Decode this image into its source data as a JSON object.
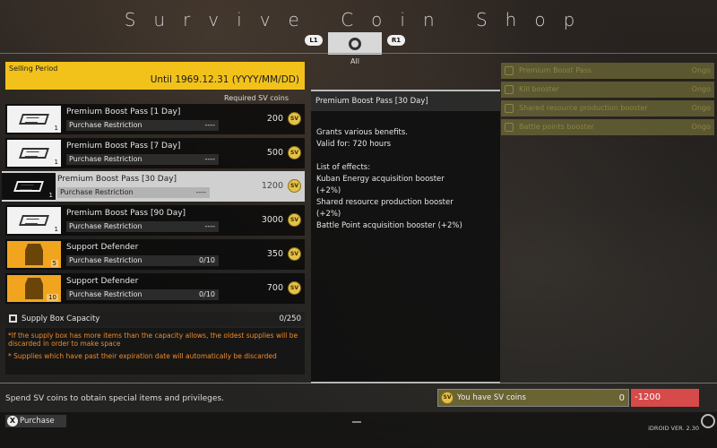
{
  "title": "Survive Coin Shop",
  "tabs": {
    "left_button": "L1",
    "right_button": "R1",
    "active_label": "All"
  },
  "selling_period": {
    "label": "Selling Period",
    "value": "Until 1969.12.31 (YYYY/MM/DD)"
  },
  "required_header": "Required SV  coins",
  "coin_label": "SV",
  "items": [
    {
      "name": "Premium Boost Pass [1 Day]",
      "qty": "1",
      "restriction_label": "Purchase Restriction",
      "restriction_value": "----",
      "price": "200",
      "icon": "ticket-icon",
      "selected": false
    },
    {
      "name": "Premium Boost Pass [7 Day]",
      "qty": "1",
      "restriction_label": "Purchase Restriction",
      "restriction_value": "----",
      "price": "500",
      "icon": "ticket-icon",
      "selected": false
    },
    {
      "name": "Premium Boost Pass [30 Day]",
      "qty": "1",
      "restriction_label": "Purchase Restriction",
      "restriction_value": "----",
      "price": "1200",
      "icon": "ticket-icon",
      "selected": true
    },
    {
      "name": "Premium Boost Pass [90 Day]",
      "qty": "1",
      "restriction_label": "Purchase Restriction",
      "restriction_value": "----",
      "price": "3000",
      "icon": "ticket-icon",
      "selected": false
    },
    {
      "name": "Support Defender",
      "qty": "5",
      "restriction_label": "Purchase Restriction",
      "restriction_value": "0/10",
      "price": "350",
      "icon": "defender-icon",
      "selected": false
    },
    {
      "name": "Support Defender",
      "qty": "10",
      "restriction_label": "Purchase Restriction",
      "restriction_value": "0/10",
      "price": "700",
      "icon": "defender-icon",
      "selected": false
    }
  ],
  "supply": {
    "label": "Supply Box Capacity",
    "value": "0/250"
  },
  "notes": [
    "*If the supply box has more items than the capacity allows, the oldest supplies will be discarded in order to make space",
    "* Supplies which have past their expiration date will automatically be discarded"
  ],
  "detail": {
    "title": "Premium Boost Pass [30 Day]",
    "body": "Grants various benefits.\nValid for: 720 hours\n\nList of effects:\n Kuban Energy acquisition booster\n(+2%)\n Shared resource production booster\n(+2%)\n Battle Point acquisition booster (+2%)"
  },
  "right_list": [
    {
      "label": "Premium Boost Pass",
      "status": "Ongo"
    },
    {
      "label": "Kill booster",
      "status": "Ongo"
    },
    {
      "label": "Shared resource production booster",
      "status": "Ongo"
    },
    {
      "label": "Battle points booster",
      "status": "Ongo"
    }
  ],
  "footer": {
    "spend_text": "Spend SV  coins to obtain special items and privileges.",
    "have_label": "You have SV  coins",
    "have_value": "0",
    "cost_value": "-1200",
    "purchase_label": "Purchase",
    "purchase_button_glyph": "X",
    "version": "iDROID VER. 2.30"
  },
  "colors": {
    "accent": "#f2c21b",
    "warning": "#f08a2b",
    "negative": "#d64a4a",
    "orange_icon": "#f1a51f"
  }
}
